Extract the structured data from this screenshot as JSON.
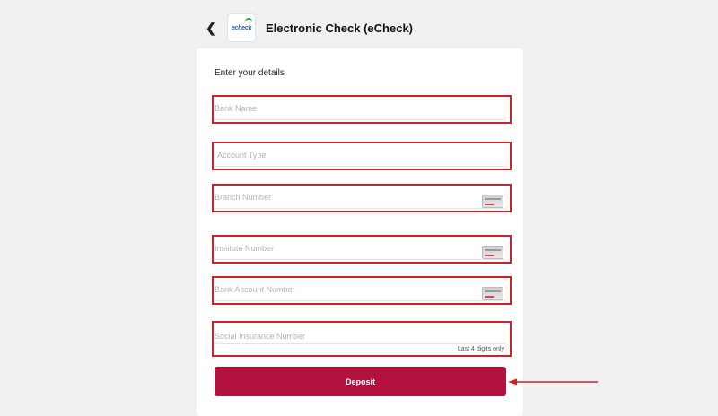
{
  "header": {
    "title": "Electronic Check (eCheck)",
    "back_icon": "chevron-left-icon",
    "logo_text": "echeck"
  },
  "form": {
    "heading": "Enter your details",
    "fields": [
      {
        "placeholder": "Bank Name"
      },
      {
        "placeholder": "Account Type"
      },
      {
        "placeholder": "Branch Number",
        "icon": "cheque-icon"
      },
      {
        "placeholder": "Institute Number",
        "icon": "cheque-icon"
      },
      {
        "placeholder": "Bank Account Number",
        "icon": "cheque-icon"
      },
      {
        "placeholder": "Social Insurance Number",
        "hint": "Last 4 digits only"
      }
    ],
    "submit_label": "Deposit"
  },
  "colors": {
    "highlight": "#d21f26",
    "button": "#b3123e",
    "background": "#eef0f2"
  }
}
